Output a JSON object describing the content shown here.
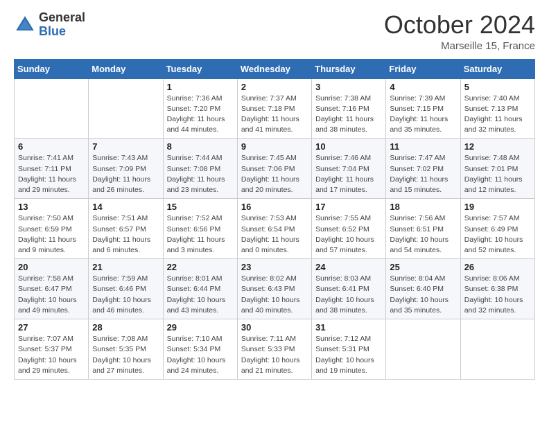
{
  "header": {
    "logo_line1": "General",
    "logo_line2": "Blue",
    "month": "October 2024",
    "location": "Marseille 15, France"
  },
  "weekdays": [
    "Sunday",
    "Monday",
    "Tuesday",
    "Wednesday",
    "Thursday",
    "Friday",
    "Saturday"
  ],
  "weeks": [
    [
      {
        "day": "",
        "detail": ""
      },
      {
        "day": "",
        "detail": ""
      },
      {
        "day": "1",
        "detail": "Sunrise: 7:36 AM\nSunset: 7:20 PM\nDaylight: 11 hours\nand 44 minutes."
      },
      {
        "day": "2",
        "detail": "Sunrise: 7:37 AM\nSunset: 7:18 PM\nDaylight: 11 hours\nand 41 minutes."
      },
      {
        "day": "3",
        "detail": "Sunrise: 7:38 AM\nSunset: 7:16 PM\nDaylight: 11 hours\nand 38 minutes."
      },
      {
        "day": "4",
        "detail": "Sunrise: 7:39 AM\nSunset: 7:15 PM\nDaylight: 11 hours\nand 35 minutes."
      },
      {
        "day": "5",
        "detail": "Sunrise: 7:40 AM\nSunset: 7:13 PM\nDaylight: 11 hours\nand 32 minutes."
      }
    ],
    [
      {
        "day": "6",
        "detail": "Sunrise: 7:41 AM\nSunset: 7:11 PM\nDaylight: 11 hours\nand 29 minutes."
      },
      {
        "day": "7",
        "detail": "Sunrise: 7:43 AM\nSunset: 7:09 PM\nDaylight: 11 hours\nand 26 minutes."
      },
      {
        "day": "8",
        "detail": "Sunrise: 7:44 AM\nSunset: 7:08 PM\nDaylight: 11 hours\nand 23 minutes."
      },
      {
        "day": "9",
        "detail": "Sunrise: 7:45 AM\nSunset: 7:06 PM\nDaylight: 11 hours\nand 20 minutes."
      },
      {
        "day": "10",
        "detail": "Sunrise: 7:46 AM\nSunset: 7:04 PM\nDaylight: 11 hours\nand 17 minutes."
      },
      {
        "day": "11",
        "detail": "Sunrise: 7:47 AM\nSunset: 7:02 PM\nDaylight: 11 hours\nand 15 minutes."
      },
      {
        "day": "12",
        "detail": "Sunrise: 7:48 AM\nSunset: 7:01 PM\nDaylight: 11 hours\nand 12 minutes."
      }
    ],
    [
      {
        "day": "13",
        "detail": "Sunrise: 7:50 AM\nSunset: 6:59 PM\nDaylight: 11 hours\nand 9 minutes."
      },
      {
        "day": "14",
        "detail": "Sunrise: 7:51 AM\nSunset: 6:57 PM\nDaylight: 11 hours\nand 6 minutes."
      },
      {
        "day": "15",
        "detail": "Sunrise: 7:52 AM\nSunset: 6:56 PM\nDaylight: 11 hours\nand 3 minutes."
      },
      {
        "day": "16",
        "detail": "Sunrise: 7:53 AM\nSunset: 6:54 PM\nDaylight: 11 hours\nand 0 minutes."
      },
      {
        "day": "17",
        "detail": "Sunrise: 7:55 AM\nSunset: 6:52 PM\nDaylight: 10 hours\nand 57 minutes."
      },
      {
        "day": "18",
        "detail": "Sunrise: 7:56 AM\nSunset: 6:51 PM\nDaylight: 10 hours\nand 54 minutes."
      },
      {
        "day": "19",
        "detail": "Sunrise: 7:57 AM\nSunset: 6:49 PM\nDaylight: 10 hours\nand 52 minutes."
      }
    ],
    [
      {
        "day": "20",
        "detail": "Sunrise: 7:58 AM\nSunset: 6:47 PM\nDaylight: 10 hours\nand 49 minutes."
      },
      {
        "day": "21",
        "detail": "Sunrise: 7:59 AM\nSunset: 6:46 PM\nDaylight: 10 hours\nand 46 minutes."
      },
      {
        "day": "22",
        "detail": "Sunrise: 8:01 AM\nSunset: 6:44 PM\nDaylight: 10 hours\nand 43 minutes."
      },
      {
        "day": "23",
        "detail": "Sunrise: 8:02 AM\nSunset: 6:43 PM\nDaylight: 10 hours\nand 40 minutes."
      },
      {
        "day": "24",
        "detail": "Sunrise: 8:03 AM\nSunset: 6:41 PM\nDaylight: 10 hours\nand 38 minutes."
      },
      {
        "day": "25",
        "detail": "Sunrise: 8:04 AM\nSunset: 6:40 PM\nDaylight: 10 hours\nand 35 minutes."
      },
      {
        "day": "26",
        "detail": "Sunrise: 8:06 AM\nSunset: 6:38 PM\nDaylight: 10 hours\nand 32 minutes."
      }
    ],
    [
      {
        "day": "27",
        "detail": "Sunrise: 7:07 AM\nSunset: 5:37 PM\nDaylight: 10 hours\nand 29 minutes."
      },
      {
        "day": "28",
        "detail": "Sunrise: 7:08 AM\nSunset: 5:35 PM\nDaylight: 10 hours\nand 27 minutes."
      },
      {
        "day": "29",
        "detail": "Sunrise: 7:10 AM\nSunset: 5:34 PM\nDaylight: 10 hours\nand 24 minutes."
      },
      {
        "day": "30",
        "detail": "Sunrise: 7:11 AM\nSunset: 5:33 PM\nDaylight: 10 hours\nand 21 minutes."
      },
      {
        "day": "31",
        "detail": "Sunrise: 7:12 AM\nSunset: 5:31 PM\nDaylight: 10 hours\nand 19 minutes."
      },
      {
        "day": "",
        "detail": ""
      },
      {
        "day": "",
        "detail": ""
      }
    ]
  ]
}
